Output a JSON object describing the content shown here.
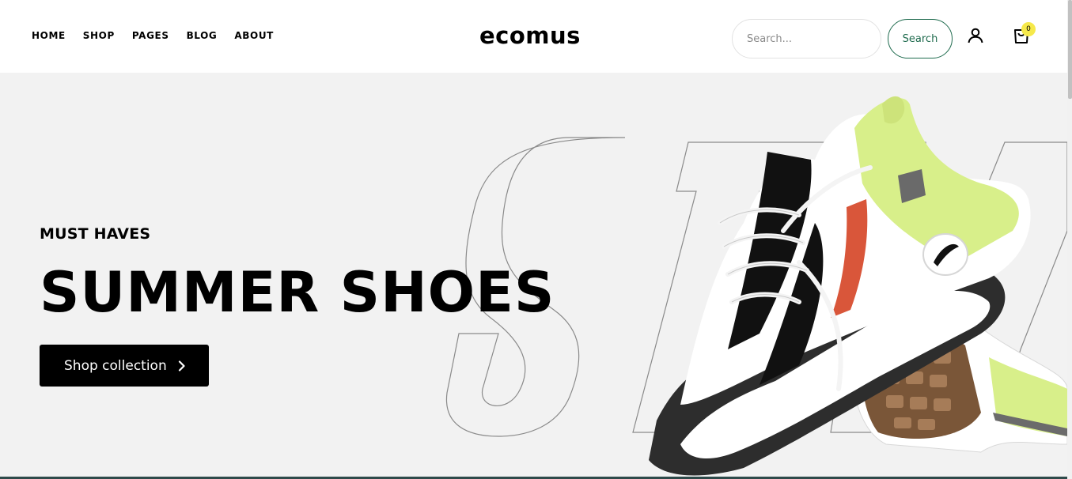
{
  "nav": {
    "items": [
      {
        "label": "HOME"
      },
      {
        "label": "SHOP"
      },
      {
        "label": "PAGES"
      },
      {
        "label": "BLOG"
      },
      {
        "label": "ABOUT"
      }
    ]
  },
  "logo": {
    "text": "ecomus"
  },
  "search": {
    "placeholder": "Search...",
    "button_label": "Search"
  },
  "account": {
    "icon": "user-icon"
  },
  "cart": {
    "icon": "cart-icon",
    "count": "0"
  },
  "hero": {
    "subtitle": "MUST HAVES",
    "title": "SUMMER SHOES",
    "cta_label": "Shop collection",
    "background_color": "#f2f2f2"
  },
  "colors": {
    "accent_green": "#1f6b4e",
    "badge_yellow": "#f6e94a",
    "text": "#000000"
  }
}
